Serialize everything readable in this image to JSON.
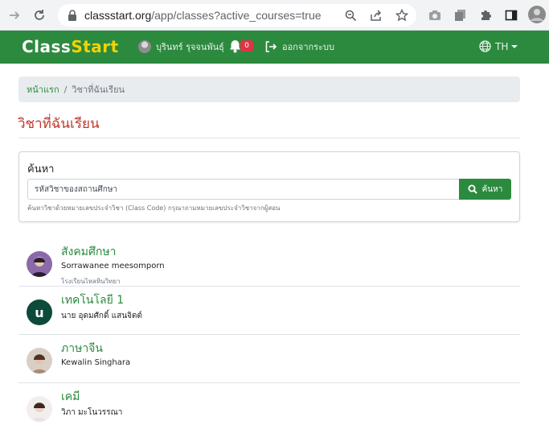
{
  "browser": {
    "url_host": "classstart.org",
    "url_path": "/app/classes?active_courses=true"
  },
  "navbar": {
    "brand_part1": "Class",
    "brand_part2": "Start",
    "user_name": "บุรินทร์ รุจจนพันธุ์",
    "notification_count": "0",
    "logout_label": "ออกจากระบบ",
    "language": "TH"
  },
  "breadcrumb": {
    "home": "หน้าแรก",
    "separator": "/",
    "current": "วิชาที่ฉันเรียน"
  },
  "page": {
    "title": "วิชาที่ฉันเรียน"
  },
  "search": {
    "label": "ค้นหา",
    "placeholder": "รหัสวิชาของสถานศึกษา",
    "button_label": "ค้นหา",
    "help_text": "ค้นหาวิชาด้วยหมายเลขประจำวิชา (Class Code) กรุณาถามหมายเลขประจำวิชาจากผู้สอน"
  },
  "courses": [
    {
      "name": "สังคมศึกษา",
      "teacher": "Sorrawanee meesomporn",
      "school": "โรงเรียนไหลหินวิทยา",
      "avatar": "photo"
    },
    {
      "name": "เทคโนโลยี 1",
      "teacher": "นาย อุดมศักดิ์ แสนจิตต์",
      "school": "",
      "avatar": "u"
    },
    {
      "name": "ภาษาจีน",
      "teacher": "Kewalin Singhara",
      "school": "",
      "avatar": "photo"
    },
    {
      "name": "เคมี",
      "teacher": "วิภา มะโนวรรณา",
      "school": "",
      "avatar": "photo"
    }
  ],
  "colors": {
    "navbar_green": "#2c8a3e",
    "brand_yellow": "#f5d300",
    "title_red": "#c0392b",
    "badge_red": "#dc3545"
  }
}
